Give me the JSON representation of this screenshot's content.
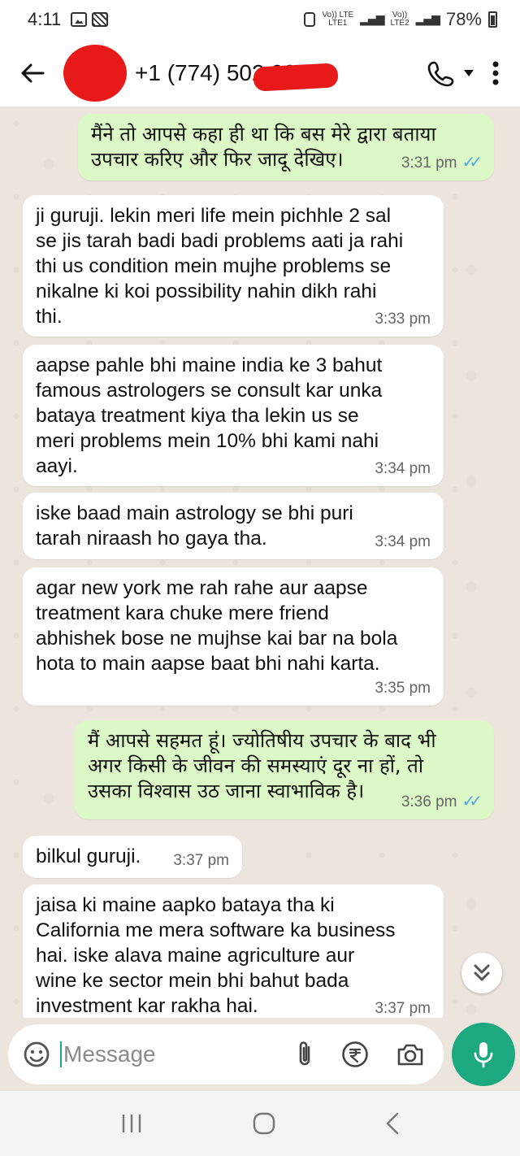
{
  "status_bar": {
    "time": "4:11",
    "net_label_1": "Vo)) LTE",
    "net_sub_1": "LTE1",
    "net_label_2": "Vo))",
    "net_sub_2": "LTE2",
    "battery": "78%"
  },
  "header": {
    "contact_name": "+1 (774) 502 0020"
  },
  "messages": [
    {
      "dir": "out",
      "text": "मैंने तो आपसे कहा ही था कि बस मेरे द्वारा बताया\nउपचार करिए और फिर जादू देखिए।",
      "time": "3:31 pm"
    },
    {
      "dir": "in",
      "text": "ji guruji. lekin meri life mein pichhle 2 sal\nse jis tarah badi badi problems aati ja rahi\nthi us condition mein mujhe problems se\nnikalne ki koi possibility nahin dikh rahi\nthi.",
      "time": "3:33 pm"
    },
    {
      "dir": "in",
      "text": "aapse pahle bhi maine india ke 3 bahut\nfamous astrologers se consult kar unka\nbataya treatment kiya tha lekin us se\nmeri problems mein 10% bhi kami nahi\naayi.",
      "time": "3:34 pm"
    },
    {
      "dir": "in",
      "text": "iske baad main astrology se bhi puri\ntarah niraash ho gaya tha.",
      "time": "3:34 pm"
    },
    {
      "dir": "in",
      "text": "agar new york me rah rahe aur aapse\ntreatment kara chuke mere friend\nabhishek bose ne mujhse kai bar na bola\nhota to main aapse baat bhi nahi karta.",
      "time": "3:35 pm"
    },
    {
      "dir": "out",
      "text": "मैं आपसे सहमत हूं। ज्योतिषीय उपचार के बाद भी\nअगर किसी के जीवन की समस्याएं दूर ना हों, तो\nउसका विश्वास उठ जाना स्वाभाविक है।",
      "time": "3:36 pm"
    },
    {
      "dir": "in",
      "text": "bilkul guruji.",
      "time": "3:37 pm"
    },
    {
      "dir": "in",
      "text": "jaisa ki maine aapko bataya tha ki\nCalifornia me mera software ka business\nhai. iske alava maine agriculture aur\nwine ke sector mein bhi bahut bada\ninvestment kar rakha hai.",
      "time": "3:37 pm"
    }
  ],
  "input": {
    "placeholder": "Message"
  },
  "colors": {
    "accent": "#1DA97F",
    "outgoing_bubble": "#DCF8C6",
    "incoming_bubble": "#FFFFFF",
    "read_ticks": "#4FA6E3",
    "redaction": "#E81919"
  },
  "icons": [
    "back-arrow-icon",
    "phone-icon",
    "dropdown-caret-icon",
    "more-vert-icon",
    "sticker-icon",
    "attach-icon",
    "rupee-payment-icon",
    "camera-icon",
    "mic-icon",
    "scroll-down-icon",
    "recents-icon",
    "home-icon",
    "nav-back-icon"
  ]
}
